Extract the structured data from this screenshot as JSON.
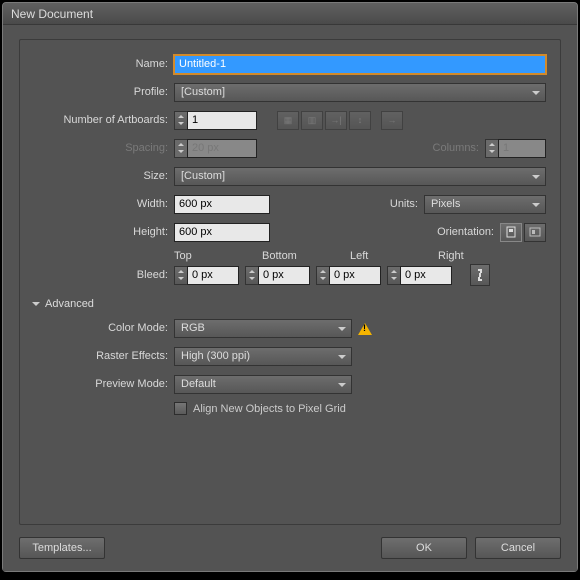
{
  "window": {
    "title": "New Document"
  },
  "labels": {
    "name": "Name:",
    "profile": "Profile:",
    "artboards": "Number of Artboards:",
    "spacing": "Spacing:",
    "columns": "Columns:",
    "size": "Size:",
    "width": "Width:",
    "height": "Height:",
    "units": "Units:",
    "orientation": "Orientation:",
    "bleed": "Bleed:",
    "top": "Top",
    "bottom": "Bottom",
    "left": "Left",
    "right": "Right",
    "advanced": "Advanced",
    "color_mode": "Color Mode:",
    "raster_effects": "Raster Effects:",
    "preview_mode": "Preview Mode:",
    "align_pixel": "Align New Objects to Pixel Grid"
  },
  "values": {
    "name": "Untitled-1",
    "profile": "[Custom]",
    "artboards": "1",
    "spacing": "20 px",
    "columns": "1",
    "size": "[Custom]",
    "width": "600 px",
    "height": "600 px",
    "units": "Pixels",
    "bleed_top": "0 px",
    "bleed_bottom": "0 px",
    "bleed_left": "0 px",
    "bleed_right": "0 px",
    "color_mode": "RGB",
    "raster_effects": "High (300 ppi)",
    "preview_mode": "Default"
  },
  "buttons": {
    "templates": "Templates...",
    "ok": "OK",
    "cancel": "Cancel"
  },
  "colors": {
    "accent": "#d28a2a"
  }
}
